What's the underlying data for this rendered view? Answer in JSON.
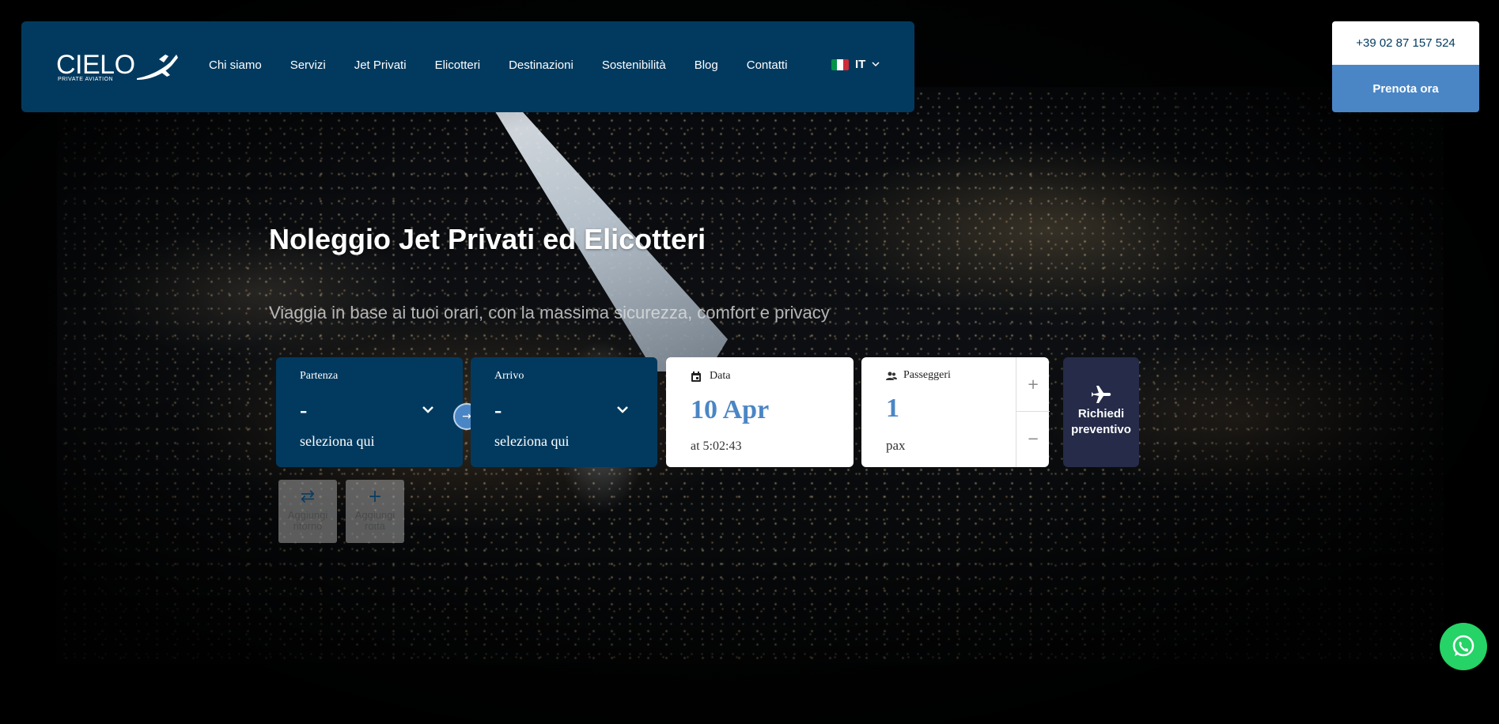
{
  "brand": {
    "name": "CIELO",
    "tagline": "PRIVATE AVIATION",
    "primary_color": "#023a5f",
    "accent_color": "#4a86c5"
  },
  "nav": {
    "items": [
      {
        "label": "Chi siamo"
      },
      {
        "label": "Servizi"
      },
      {
        "label": "Jet Privati"
      },
      {
        "label": "Elicotteri"
      },
      {
        "label": "Destinazioni"
      },
      {
        "label": "Sostenibilità"
      },
      {
        "label": "Blog"
      },
      {
        "label": "Contatti"
      }
    ],
    "language": "IT"
  },
  "header": {
    "phone": "+39 02 87 157 524",
    "cta": "Prenota ora"
  },
  "hero": {
    "title": "Noleggio Jet Privati ed Elicotteri",
    "subtitle": "Viaggia in base ai tuoi orari, con la massima sicurezza, comfort e privacy"
  },
  "booking": {
    "departure": {
      "label": "Partenza",
      "value": "-",
      "hint": "seleziona qui"
    },
    "arrival": {
      "label": "Arrivo",
      "value": "-",
      "hint": "seleziona qui"
    },
    "swap_icon": "arrow-right-icon",
    "date": {
      "label": "Data",
      "value": "10 Apr",
      "time": "at 5:02:43"
    },
    "passengers": {
      "label": "Passeggeri",
      "value": "1",
      "unit": "pax",
      "plus": "+",
      "minus": "−"
    },
    "submit": {
      "label_line1": "Richiedi",
      "label_line2": "preventivo"
    },
    "add_return": {
      "label_line1": "Aggiungi",
      "label_line2": "ritorno"
    },
    "add_route": {
      "label_line1": "Aggiungi",
      "label_line2": "rotta"
    }
  }
}
